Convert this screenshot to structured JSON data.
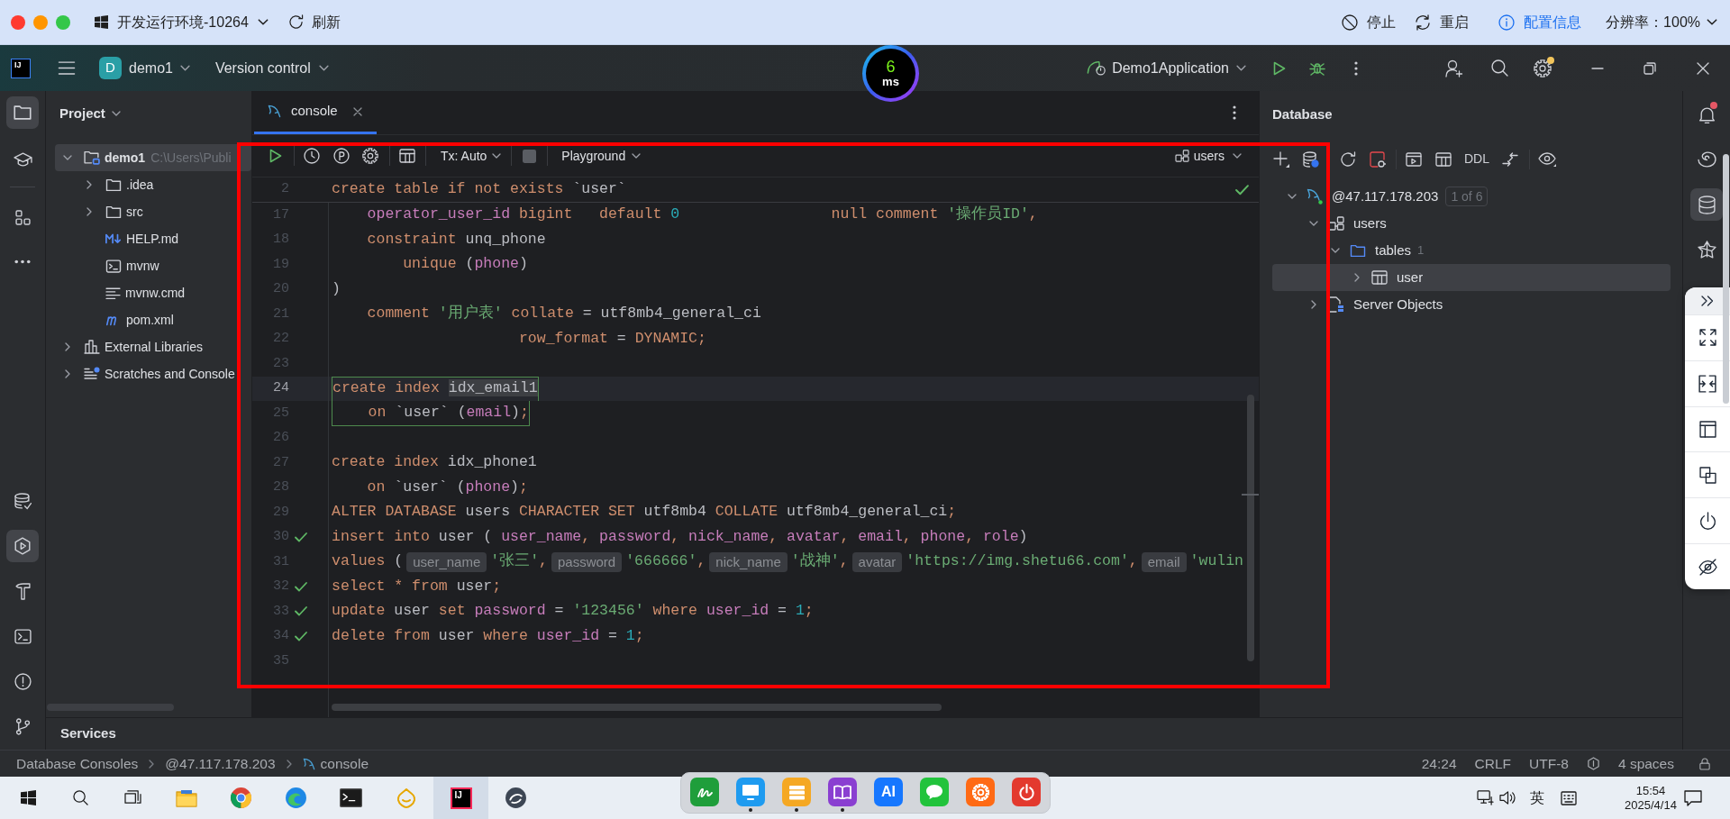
{
  "browser_bar": {
    "window_controls": [
      {
        "kind": "close"
      },
      {
        "kind": "minimize"
      },
      {
        "kind": "maximize"
      }
    ],
    "environment": "开发运行环境-10264",
    "refresh": "刷新",
    "actions": [
      {
        "kind": "stop",
        "label": "停止"
      },
      {
        "kind": "restart",
        "label": "重启"
      },
      {
        "kind": "info",
        "label": "配置信息"
      }
    ],
    "resolution": "分辨率：100%"
  },
  "title_bar": {
    "logo": "IJ",
    "project_badge": "D",
    "project": "demo1",
    "vcs": "Version control",
    "latency": {
      "value": "6",
      "unit": "ms"
    },
    "run_config": "Demo1Application",
    "settings_update": true
  },
  "left_toolbar": {
    "top": [
      [
        {
          "kind": "project",
          "selected": true
        },
        {
          "kind": "learn",
          "selected": false
        }
      ],
      [
        {
          "kind": "structure",
          "selected": false
        },
        {
          "kind": "more",
          "selected": false
        }
      ]
    ],
    "bottom": [
      {
        "kind": "database_changes",
        "selected": false
      },
      {
        "kind": "services",
        "selected": true
      },
      {
        "kind": "build",
        "selected": false
      },
      {
        "kind": "terminal",
        "selected": false
      },
      {
        "kind": "problems",
        "selected": false
      },
      {
        "kind": "git",
        "selected": false
      }
    ]
  },
  "project": {
    "title": "Project",
    "tree": [
      {
        "label": "demo1",
        "path": "C:\\Users\\Publi",
        "kind": "module",
        "expanded": true,
        "selected": true,
        "children": [
          {
            "label": ".idea",
            "kind": "folder",
            "expanded": false,
            "selected": false
          },
          {
            "label": "src",
            "kind": "folder",
            "expanded": false,
            "selected": false
          },
          {
            "label": "HELP.md",
            "kind": "markdown",
            "selected": false
          },
          {
            "label": "mvnw",
            "kind": "script",
            "selected": false
          },
          {
            "label": "mvnw.cmd",
            "kind": "text",
            "selected": false
          },
          {
            "label": "pom.xml",
            "kind": "maven",
            "selected": false
          }
        ]
      },
      {
        "label": "External Libraries",
        "kind": "libraries",
        "expanded": false,
        "selected": false
      },
      {
        "label": "Scratches and Console",
        "kind": "scratches",
        "expanded": false,
        "selected": false
      }
    ]
  },
  "editor": {
    "tabs": [
      {
        "label": "console",
        "selected": true
      }
    ],
    "toolbar": {
      "transaction": "Tx: Auto",
      "mode": "Playground",
      "schema": "users"
    },
    "inspection_ok": true,
    "sticky_line": {
      "number": "2",
      "tokens": [
        {
          "kind": "keyword",
          "text": "create table if not exists "
        },
        {
          "kind": "plain",
          "text": "`user`"
        }
      ]
    },
    "lines": [
      {
        "number": "17",
        "check": false,
        "current": false,
        "outlined": false,
        "tokens": [
          {
            "kind": "column",
            "text": "    operator_user_id"
          },
          {
            "kind": "keyword",
            "text": " bigint   default "
          },
          {
            "kind": "number",
            "text": "0"
          },
          {
            "kind": "keyword",
            "text": "                 null comment "
          },
          {
            "kind": "string",
            "text": "'操作员ID'"
          },
          {
            "kind": "keyword",
            "text": ","
          }
        ]
      },
      {
        "number": "18",
        "check": false,
        "current": false,
        "outlined": false,
        "tokens": [
          {
            "kind": "keyword",
            "text": "    constraint "
          },
          {
            "kind": "plain",
            "text": "unq_phone"
          }
        ]
      },
      {
        "number": "19",
        "check": false,
        "current": false,
        "outlined": false,
        "tokens": [
          {
            "kind": "keyword",
            "text": "        unique "
          },
          {
            "kind": "plain",
            "text": "("
          },
          {
            "kind": "column",
            "text": "phone"
          },
          {
            "kind": "plain",
            "text": ")"
          }
        ]
      },
      {
        "number": "20",
        "check": false,
        "current": false,
        "outlined": false,
        "tokens": [
          {
            "kind": "plain",
            "text": ")"
          }
        ]
      },
      {
        "number": "21",
        "check": false,
        "current": false,
        "outlined": false,
        "tokens": [
          {
            "kind": "keyword",
            "text": "    comment "
          },
          {
            "kind": "string",
            "text": "'用户表'"
          },
          {
            "kind": "keyword",
            "text": " collate "
          },
          {
            "kind": "plain",
            "text": "= utf8mb4_general_ci"
          }
        ]
      },
      {
        "number": "22",
        "check": false,
        "current": false,
        "outlined": false,
        "tokens": [
          {
            "kind": "keyword",
            "text": "                     row_format "
          },
          {
            "kind": "plain",
            "text": "= "
          },
          {
            "kind": "keyword",
            "text": "DYNAMIC;"
          }
        ]
      },
      {
        "number": "23",
        "check": false,
        "current": false,
        "outlined": false
      },
      {
        "number": "24",
        "check": false,
        "current": true,
        "outlined": true,
        "tokens": [
          {
            "kind": "keyword",
            "text": "create index "
          },
          {
            "kind": "highlight",
            "text": "idx_email1"
          }
        ]
      },
      {
        "number": "25",
        "check": false,
        "current": false,
        "outlined": true,
        "tokens": [
          {
            "kind": "keyword",
            "text": "    on "
          },
          {
            "kind": "plain",
            "text": "`user` ("
          },
          {
            "kind": "column",
            "text": "email"
          },
          {
            "kind": "plain",
            "text": ")"
          },
          {
            "kind": "keyword",
            "text": ";"
          }
        ]
      },
      {
        "number": "26",
        "check": false,
        "current": false,
        "outlined": false
      },
      {
        "number": "27",
        "check": false,
        "current": false,
        "outlined": false,
        "tokens": [
          {
            "kind": "keyword",
            "text": "create index "
          },
          {
            "kind": "plain",
            "text": "idx_phone1"
          }
        ]
      },
      {
        "number": "28",
        "check": false,
        "current": false,
        "outlined": false,
        "tokens": [
          {
            "kind": "keyword",
            "text": "    on "
          },
          {
            "kind": "plain",
            "text": "`user` ("
          },
          {
            "kind": "column",
            "text": "phone"
          },
          {
            "kind": "plain",
            "text": ")"
          },
          {
            "kind": "keyword",
            "text": ";"
          }
        ]
      },
      {
        "number": "29",
        "check": false,
        "current": false,
        "outlined": false,
        "tokens": [
          {
            "kind": "keyword",
            "text": "ALTER DATABASE "
          },
          {
            "kind": "plain",
            "text": "users "
          },
          {
            "kind": "keyword",
            "text": "CHARACTER SET "
          },
          {
            "kind": "plain",
            "text": "utf8mb4 "
          },
          {
            "kind": "keyword",
            "text": "COLLATE "
          },
          {
            "kind": "plain",
            "text": "utf8mb4_general_ci"
          },
          {
            "kind": "keyword",
            "text": ";"
          }
        ]
      },
      {
        "number": "30",
        "check": true,
        "current": false,
        "outlined": false,
        "tokens": [
          {
            "kind": "keyword",
            "text": "insert into "
          },
          {
            "kind": "plain",
            "text": "user ( "
          },
          {
            "kind": "column",
            "text": "user_name"
          },
          {
            "kind": "keyword",
            "text": ", "
          },
          {
            "kind": "column",
            "text": "password"
          },
          {
            "kind": "keyword",
            "text": ", "
          },
          {
            "kind": "column",
            "text": "nick_name"
          },
          {
            "kind": "keyword",
            "text": ", "
          },
          {
            "kind": "column",
            "text": "avatar"
          },
          {
            "kind": "keyword",
            "text": ", "
          },
          {
            "kind": "column",
            "text": "email"
          },
          {
            "kind": "keyword",
            "text": ", "
          },
          {
            "kind": "column",
            "text": "phone"
          },
          {
            "kind": "keyword",
            "text": ", "
          },
          {
            "kind": "column",
            "text": "role"
          },
          {
            "kind": "plain",
            "text": ")"
          }
        ]
      },
      {
        "number": "31",
        "check": false,
        "current": false,
        "outlined": false,
        "tokens": [
          {
            "kind": "keyword",
            "text": "values "
          },
          {
            "kind": "plain",
            "text": "("
          },
          {
            "kind": "hint",
            "text": "user_name"
          },
          {
            "kind": "string",
            "text": "'张三'"
          },
          {
            "kind": "keyword",
            "text": ","
          },
          {
            "kind": "hint",
            "text": "password"
          },
          {
            "kind": "string",
            "text": "'666666'"
          },
          {
            "kind": "keyword",
            "text": ","
          },
          {
            "kind": "hint",
            "text": "nick_name"
          },
          {
            "kind": "string",
            "text": "'战神'"
          },
          {
            "kind": "keyword",
            "text": ","
          },
          {
            "kind": "hint",
            "text": "avatar"
          },
          {
            "kind": "string",
            "text": "'https://img.shetu66.com'"
          },
          {
            "kind": "keyword",
            "text": ","
          },
          {
            "kind": "hint",
            "text": "email"
          },
          {
            "kind": "string",
            "text": "'wulin"
          }
        ]
      },
      {
        "number": "32",
        "check": true,
        "current": false,
        "outlined": false,
        "tokens": [
          {
            "kind": "keyword",
            "text": "select * from "
          },
          {
            "kind": "plain",
            "text": "user"
          },
          {
            "kind": "keyword",
            "text": ";"
          }
        ]
      },
      {
        "number": "33",
        "check": true,
        "current": false,
        "outlined": false,
        "tokens": [
          {
            "kind": "keyword",
            "text": "update "
          },
          {
            "kind": "plain",
            "text": "user "
          },
          {
            "kind": "keyword",
            "text": "set "
          },
          {
            "kind": "column",
            "text": "password"
          },
          {
            "kind": "plain",
            "text": " = "
          },
          {
            "kind": "string",
            "text": "'123456'"
          },
          {
            "kind": "keyword",
            "text": " where "
          },
          {
            "kind": "column",
            "text": "user_id"
          },
          {
            "kind": "plain",
            "text": " = "
          },
          {
            "kind": "number",
            "text": "1"
          },
          {
            "kind": "keyword",
            "text": ";"
          }
        ]
      },
      {
        "number": "34",
        "check": true,
        "current": false,
        "outlined": false,
        "tokens": [
          {
            "kind": "keyword",
            "text": "delete from "
          },
          {
            "kind": "plain",
            "text": "user "
          },
          {
            "kind": "keyword",
            "text": "where "
          },
          {
            "kind": "column",
            "text": "user_id"
          },
          {
            "kind": "plain",
            "text": " = "
          },
          {
            "kind": "number",
            "text": "1"
          },
          {
            "kind": "keyword",
            "text": ";"
          }
        ]
      },
      {
        "number": "35",
        "check": false,
        "current": false,
        "outlined": false
      }
    ]
  },
  "database": {
    "title": "Database",
    "toolbar_text": "DDL",
    "tree": [
      {
        "label": "@47.117.178.203",
        "badge": "1 of 6",
        "kind": "connection",
        "expanded": true,
        "selected": false,
        "children": [
          {
            "label": "users",
            "kind": "schema",
            "expanded": true,
            "selected": false,
            "children": [
              {
                "label": "tables",
                "count": "1",
                "kind": "folder",
                "expanded": true,
                "selected": false,
                "children": [
                  {
                    "label": "user",
                    "kind": "table",
                    "expanded": false,
                    "selected": true
                  }
                ]
              }
            ]
          },
          {
            "label": "Server Objects",
            "kind": "server_objects",
            "expanded": false,
            "selected": false
          }
        ]
      }
    ]
  },
  "right_toolbar": [
    {
      "kind": "notifications",
      "selected": false,
      "unread": true
    },
    {
      "kind": "ai",
      "selected": false
    },
    {
      "kind": "database",
      "selected": true
    },
    {
      "kind": "plugin",
      "selected": false
    }
  ],
  "floating_panel": [
    {
      "kind": "collapse"
    },
    {
      "kind": "fullscreen"
    },
    {
      "kind": "split"
    },
    {
      "kind": "layout"
    },
    {
      "kind": "copy"
    },
    {
      "kind": "power"
    },
    {
      "kind": "hide"
    }
  ],
  "services": {
    "title": "Services"
  },
  "status_bar": {
    "breadcrumbs": [
      {
        "kind": "text",
        "label": "Database Consoles"
      },
      {
        "kind": "text",
        "label": "@47.117.178.203"
      },
      {
        "kind": "console",
        "label": "console"
      }
    ],
    "right": [
      {
        "kind": "position",
        "label": "24:24"
      },
      {
        "kind": "line_ending",
        "label": "CRLF"
      },
      {
        "kind": "encoding",
        "label": "UTF-8"
      },
      {
        "kind": "indicator"
      },
      {
        "kind": "indent",
        "label": "4 spaces"
      },
      {
        "kind": "lock"
      }
    ]
  },
  "taskbar": {
    "system": [
      {
        "kind": "start"
      },
      {
        "kind": "search"
      },
      {
        "kind": "task_view"
      }
    ],
    "apps": [
      {
        "kind": "folder",
        "selected": false
      },
      {
        "kind": "segmented",
        "selected": false
      },
      {
        "kind": "swirl",
        "selected": false
      },
      {
        "kind": "terminal",
        "selected": false
      },
      {
        "kind": "outline",
        "selected": false
      },
      {
        "kind": "ide",
        "label": "IJ",
        "selected": true
      },
      {
        "kind": "round",
        "selected": false
      }
    ],
    "tray": {
      "ime": "英",
      "time": "15:54",
      "date": "2025/4/14"
    }
  },
  "dock": [
    {
      "kind": "sign",
      "color": "#1f9e3b",
      "running": false
    },
    {
      "kind": "monitor",
      "color": "#1e9bf0",
      "running": true
    },
    {
      "kind": "list",
      "color": "#f5a823",
      "running": true
    },
    {
      "kind": "book",
      "color": "#8a3fd1",
      "running": true
    },
    {
      "kind": "ai",
      "label": "AI",
      "color": "#1677ff",
      "running": false
    },
    {
      "kind": "chat",
      "color": "#22c33c",
      "running": false
    },
    {
      "kind": "gear",
      "color": "#ff6a14",
      "running": false
    },
    {
      "kind": "power",
      "color": "#e3392e",
      "running": false
    }
  ],
  "annotation_frame": true
}
